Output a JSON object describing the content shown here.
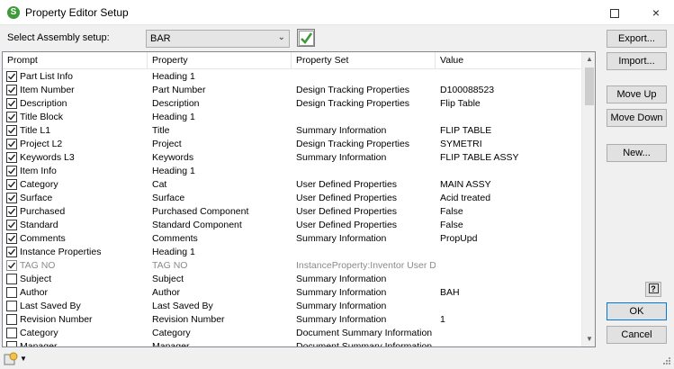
{
  "window": {
    "title": "Property Editor Setup",
    "app_icon_letter": "S",
    "maximize_icon": "maximize-icon",
    "close_icon": "×"
  },
  "assembly_setup": {
    "label": "Select Assembly setup:",
    "selected": "BAR",
    "apply_icon": "green-checkmark-icon"
  },
  "grid": {
    "columns": [
      "Prompt",
      "Property",
      "Property Set",
      "Value"
    ],
    "rows": [
      {
        "checked": true,
        "disabled": false,
        "prompt": "Part List Info",
        "property": "Heading 1",
        "set": "",
        "value": ""
      },
      {
        "checked": true,
        "disabled": false,
        "prompt": "Item Number",
        "property": "Part Number",
        "set": "Design Tracking Properties",
        "value": "D100088523"
      },
      {
        "checked": true,
        "disabled": false,
        "prompt": "Description",
        "property": "Description",
        "set": "Design Tracking Properties",
        "value": "Flip Table"
      },
      {
        "checked": true,
        "disabled": false,
        "prompt": "Title Block",
        "property": "Heading 1",
        "set": "",
        "value": ""
      },
      {
        "checked": true,
        "disabled": false,
        "prompt": "Title L1",
        "property": "Title",
        "set": "Summary Information",
        "value": "FLIP TABLE"
      },
      {
        "checked": true,
        "disabled": false,
        "prompt": "Project L2",
        "property": "Project",
        "set": "Design Tracking Properties",
        "value": "SYMETRI"
      },
      {
        "checked": true,
        "disabled": false,
        "prompt": "Keywords L3",
        "property": "Keywords",
        "set": "Summary Information",
        "value": "FLIP TABLE ASSY"
      },
      {
        "checked": true,
        "disabled": false,
        "prompt": "Item Info",
        "property": "Heading 1",
        "set": "",
        "value": ""
      },
      {
        "checked": true,
        "disabled": false,
        "prompt": "Category",
        "property": "Cat",
        "set": "User Defined Properties",
        "value": "MAIN ASSY"
      },
      {
        "checked": true,
        "disabled": false,
        "prompt": "Surface",
        "property": "Surface",
        "set": "User Defined Properties",
        "value": "Acid treated"
      },
      {
        "checked": true,
        "disabled": false,
        "prompt": "Purchased",
        "property": "Purchased Component",
        "set": "User Defined Properties",
        "value": "False"
      },
      {
        "checked": true,
        "disabled": false,
        "prompt": "Standard",
        "property": "Standard Component",
        "set": "User Defined Properties",
        "value": "False"
      },
      {
        "checked": true,
        "disabled": false,
        "prompt": "Comments",
        "property": "Comments",
        "set": "Summary Information",
        "value": "PropUpd"
      },
      {
        "checked": true,
        "disabled": false,
        "prompt": "Instance Properties",
        "property": "Heading 1",
        "set": "",
        "value": ""
      },
      {
        "checked": true,
        "disabled": true,
        "prompt": "TAG NO",
        "property": "TAG NO",
        "set": "InstanceProperty:Inventor User D...",
        "value": ""
      },
      {
        "checked": false,
        "disabled": false,
        "prompt": "Subject",
        "property": "Subject",
        "set": "Summary Information",
        "value": ""
      },
      {
        "checked": false,
        "disabled": false,
        "prompt": "Author",
        "property": "Author",
        "set": "Summary Information",
        "value": "BAH"
      },
      {
        "checked": false,
        "disabled": false,
        "prompt": "Last Saved By",
        "property": "Last Saved By",
        "set": "Summary Information",
        "value": ""
      },
      {
        "checked": false,
        "disabled": false,
        "prompt": "Revision Number",
        "property": "Revision Number",
        "set": "Summary Information",
        "value": "1"
      },
      {
        "checked": false,
        "disabled": false,
        "prompt": "Category",
        "property": "Category",
        "set": "Document Summary Information",
        "value": ""
      },
      {
        "checked": false,
        "disabled": false,
        "prompt": "Manager",
        "property": "Manager",
        "set": "Document Summary Information",
        "value": ""
      }
    ]
  },
  "buttons": {
    "export": "Export...",
    "import": "Import...",
    "move_up": "Move Up",
    "move_down": "Move Down",
    "new": "New...",
    "ok": "OK",
    "cancel": "Cancel",
    "help": "?"
  },
  "colors": {
    "check_green": "#3f9a3a",
    "default_button_border": "#0078d7"
  }
}
